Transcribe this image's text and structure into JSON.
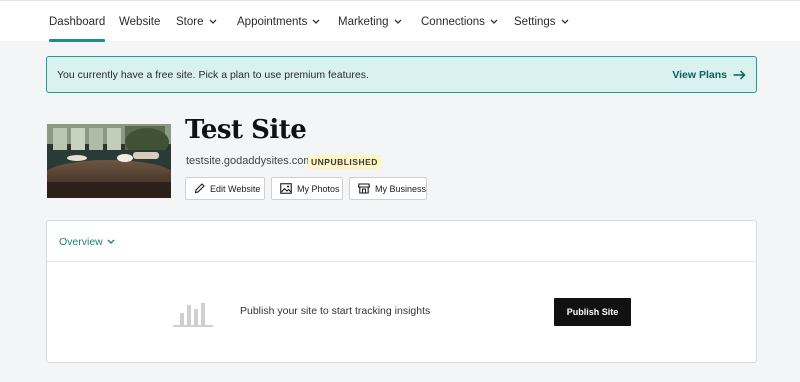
{
  "nav": {
    "items": [
      {
        "label": "Dashboard",
        "active": true,
        "dropdown": false
      },
      {
        "label": "Website",
        "active": false,
        "dropdown": false
      },
      {
        "label": "Store",
        "active": false,
        "dropdown": true
      },
      {
        "label": "Appointments",
        "active": false,
        "dropdown": true
      },
      {
        "label": "Marketing",
        "active": false,
        "dropdown": true
      },
      {
        "label": "Connections",
        "active": false,
        "dropdown": true
      },
      {
        "label": "Settings",
        "active": false,
        "dropdown": true
      }
    ]
  },
  "banner": {
    "message": "You currently have a free site. Pick a plan to use premium features.",
    "link_label": "View Plans",
    "link_icon": "arrow-right-icon"
  },
  "site": {
    "title": "Test Site",
    "url": "testsite.godaddysites.com",
    "status_badge": "UNPUBLISHED",
    "thumbnail": "cafe-table-photo",
    "actions": {
      "edit_label": "Edit Website",
      "photos_label": "My Photos",
      "business_label": "My Business"
    }
  },
  "overview": {
    "dropdown_label": "Overview",
    "insights_message": "Publish your site to start tracking insights",
    "publish_label": "Publish Site",
    "icon": "bar-chart-icon"
  },
  "colors": {
    "accent": "#1b8f8d",
    "banner_bg": "#d9f1ef",
    "banner_border": "#1e9e99",
    "badge_bg": "#fff4c4",
    "primary_button": "#111111",
    "page_bg": "#f4f5f6"
  }
}
